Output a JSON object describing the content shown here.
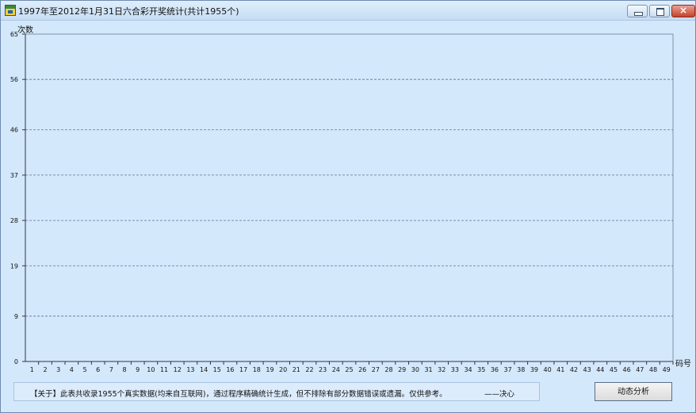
{
  "window": {
    "title": "1997年至2012年1月31日六合彩开奖统计(共计1955个)",
    "close_glyph": "×"
  },
  "chart_data": {
    "type": "bar",
    "categories": [
      "1",
      "2",
      "3",
      "4",
      "5",
      "6",
      "7",
      "8",
      "9",
      "10",
      "11",
      "12",
      "13",
      "14",
      "15",
      "16",
      "17",
      "18",
      "19",
      "20",
      "21",
      "22",
      "23",
      "24",
      "25",
      "26",
      "27",
      "28",
      "29",
      "30",
      "31",
      "32",
      "33",
      "34",
      "35",
      "36",
      "37",
      "38",
      "39",
      "40",
      "41",
      "42",
      "43",
      "44",
      "45",
      "46",
      "47",
      "48",
      "49"
    ],
    "values": [],
    "ylabel": "次数",
    "xlabel": "码号",
    "ylim": [
      0,
      65
    ],
    "yticks": [
      0,
      9,
      19,
      28,
      37,
      46,
      56,
      65
    ],
    "grid": true
  },
  "footer": {
    "info_text": "【关于】此表共收录1955个真实数据(均来自互联网)，通过程序精确统计生成，但不排除有部分数据错误或遗漏。仅供参考。",
    "signature": "——决心"
  },
  "actions": {
    "analyze_label": "动态分析"
  }
}
